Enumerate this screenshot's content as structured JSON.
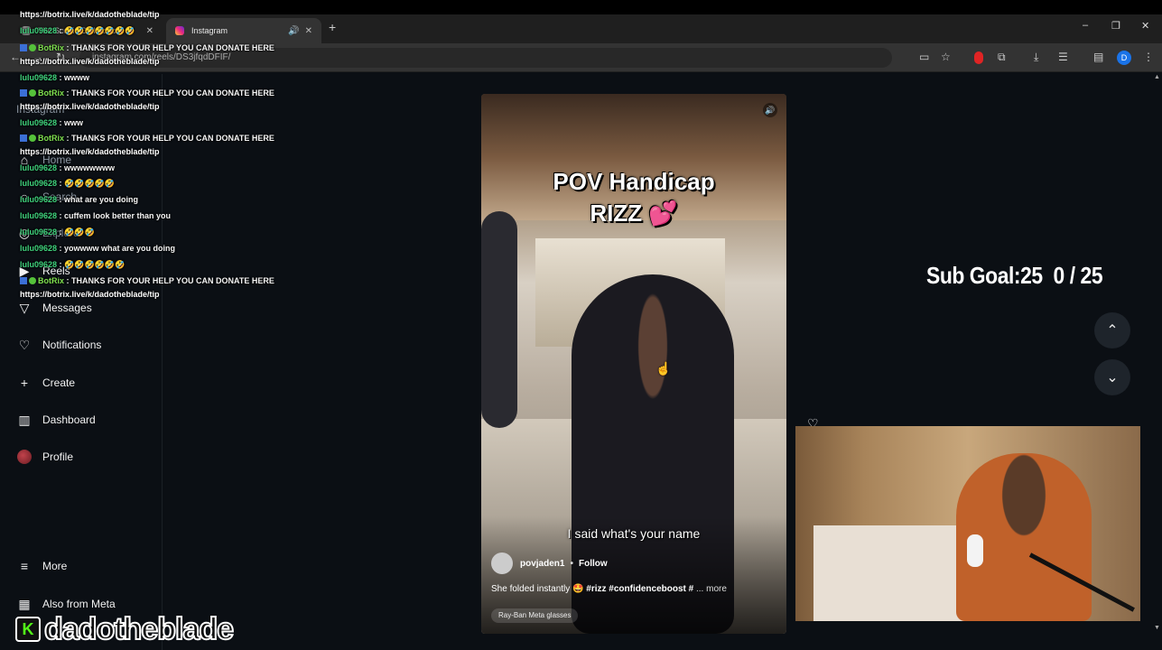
{
  "browser": {
    "tabs": [
      {
        "label": "The Scottie Dell Adobe",
        "close": "✕"
      },
      {
        "label": "Instagram",
        "audio": "🔊",
        "close": "✕"
      }
    ],
    "new_tab": "+",
    "url": "instagram.com/reels/DS3jfqdDFIF/",
    "window_controls": {
      "minimize": "–",
      "restore": "❐",
      "close": "✕"
    },
    "profile_initial": "D"
  },
  "sidebar": {
    "items": [
      {
        "label": "Instagram",
        "icon": "instagram-icon"
      },
      {
        "label": "Home",
        "icon": "home-icon"
      },
      {
        "label": "Search",
        "icon": "search-icon"
      },
      {
        "label": "Explore",
        "icon": "compass-icon"
      },
      {
        "label": "Reels",
        "icon": "reels-icon"
      },
      {
        "label": "Messages",
        "icon": "send-icon"
      },
      {
        "label": "Notifications",
        "icon": "heart-icon"
      },
      {
        "label": "Create",
        "icon": "plus-icon"
      },
      {
        "label": "Dashboard",
        "icon": "dashboard-icon"
      },
      {
        "label": "Profile",
        "icon": "avatar"
      },
      {
        "label": "More",
        "icon": "menu-icon"
      },
      {
        "label": "Also from Meta",
        "icon": "meta-icon"
      }
    ]
  },
  "chat": {
    "lines": [
      {
        "type": "url",
        "text": "https://botrix.live/k/dadotheblade/tip"
      },
      {
        "type": "msg",
        "user": "lulu09628",
        "text": " : 🤣🤣🤣🤣🤣🤣🤣"
      },
      {
        "type": "bot",
        "user": "BotRix",
        "text": " : THANKS FOR YOUR HELP YOU CAN DONATE HERE"
      },
      {
        "type": "url",
        "text": "https://botrix.live/k/dadotheblade/tip"
      },
      {
        "type": "msg",
        "user": "lulu09628",
        "text": " : wwww"
      },
      {
        "type": "bot",
        "user": "BotRix",
        "text": " : THANKS FOR YOUR HELP YOU CAN DONATE HERE"
      },
      {
        "type": "url",
        "text": "https://botrix.live/k/dadotheblade/tip"
      },
      {
        "type": "msg",
        "user": "lulu09628",
        "text": " : www"
      },
      {
        "type": "bot",
        "user": "BotRix",
        "text": " : THANKS FOR YOUR HELP YOU CAN DONATE HERE"
      },
      {
        "type": "url",
        "text": "https://botrix.live/k/dadotheblade/tip"
      },
      {
        "type": "msg",
        "user": "lulu09628",
        "text": " : wwwwwwww"
      },
      {
        "type": "msg",
        "user": "lulu09628",
        "text": " : 🤣🤣🤣🤣🤣"
      },
      {
        "type": "msg",
        "user": "lulu09628",
        "text": " : what are you doing"
      },
      {
        "type": "msg",
        "user": "lulu09628",
        "text": " : cuffem look better than you"
      },
      {
        "type": "msg",
        "user": "lulu09628",
        "text": " : 🤣🤣🤣"
      },
      {
        "type": "msg",
        "user": "lulu09628",
        "text": " : yowwww what are you doing"
      },
      {
        "type": "msg",
        "user": "lulu09628",
        "text": " : 🤣🤣🤣🤣🤣🤣"
      },
      {
        "type": "bot",
        "user": "BotRix",
        "text": " : THANKS FOR YOUR HELP YOU CAN DONATE HERE"
      },
      {
        "type": "url",
        "text": "https://botrix.live/k/dadotheblade/tip"
      }
    ]
  },
  "reel": {
    "overlay_line1": "POV Handicap",
    "overlay_line2": "RIZZ",
    "overlay_emoji": "💕",
    "subtitle": "I said what's your name",
    "author": "povjaden1",
    "separator": "•",
    "follow": "Follow",
    "description_prefix": "She folded instantly 🤩 ",
    "description_tags": "#rizz #confidenceboost #",
    "description_more": "... more",
    "glasses": "Ray-Ban Meta glasses"
  },
  "stream": {
    "sub_goal": "Sub Goal:25",
    "sub_count": "0 / 25",
    "channel": "dadotheblade",
    "kick_logo": "K"
  },
  "colors": {
    "background": "#0b0f14",
    "chat_user": "#3fd27c",
    "kick_green": "#53fc18"
  }
}
